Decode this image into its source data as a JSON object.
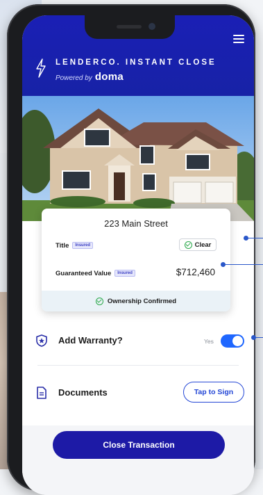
{
  "app": {
    "brand_title": "LENDERCO. INSTANT CLOSE",
    "powered_by": "Powered by",
    "powered_brand": "doma"
  },
  "property": {
    "address": "223 Main Street",
    "title_label": "Title",
    "title_badge": "Insured",
    "title_status": "Clear",
    "value_label": "Guaranteed Value",
    "value_badge": "Insured",
    "value_amount": "$712,460",
    "footer_status": "Ownership Confirmed"
  },
  "warranty": {
    "label": "Add Warranty?",
    "toggle_text": "Yes",
    "enabled": true
  },
  "documents": {
    "label": "Documents",
    "action_label": "Tap to Sign"
  },
  "cta": {
    "label": "Close Transaction"
  },
  "colors": {
    "header_blue": "#1a1fb5",
    "accent_blue": "#1f67ff",
    "success_green": "#2aa84a",
    "cta_blue": "#1d1aa6"
  }
}
